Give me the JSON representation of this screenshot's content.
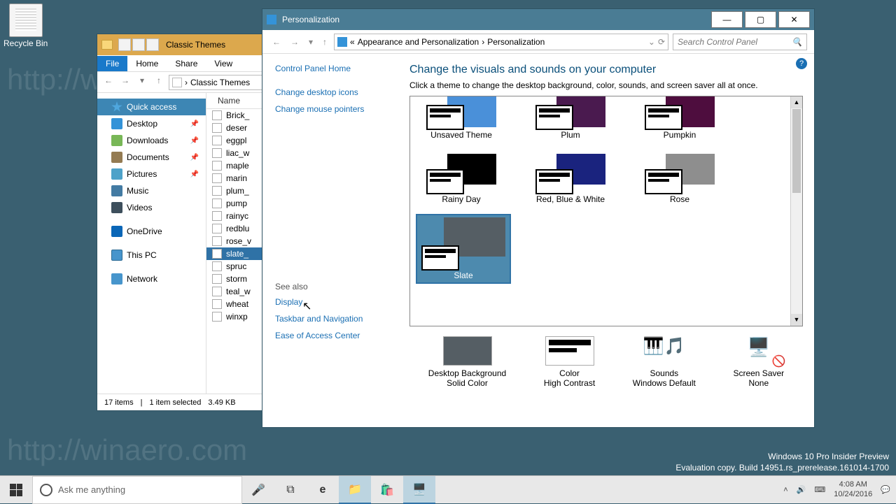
{
  "desktop": {
    "recycle_bin": "Recycle Bin"
  },
  "watermark": {
    "line1": "Windows 10 Pro Insider Preview",
    "line2": "Evaluation copy. Build 14951.rs_prerelease.161014-1700"
  },
  "explorer": {
    "title": "Classic Themes",
    "tabs": {
      "file": "File",
      "home": "Home",
      "share": "Share",
      "view": "View"
    },
    "breadcrumb": "Classic Themes",
    "columns": {
      "name": "Name"
    },
    "sidebar": {
      "quick": "Quick access",
      "desktop": "Desktop",
      "downloads": "Downloads",
      "documents": "Documents",
      "pictures": "Pictures",
      "music": "Music",
      "videos": "Videos",
      "onedrive": "OneDrive",
      "thispc": "This PC",
      "network": "Network"
    },
    "files": {
      "0": "Brick_",
      "1": "deser",
      "2": "eggpl",
      "3": "liac_w",
      "4": "maple",
      "5": "marin",
      "6": "plum_",
      "7": "pump",
      "8": "rainyc",
      "9": "redblu",
      "10": "rose_v",
      "11": "slate_",
      "12": "spruc",
      "13": "storm",
      "14": "teal_w",
      "15": "wheat",
      "16": "winxp"
    },
    "status": {
      "items": "17 items",
      "selected": "1 item selected",
      "size": "3.49 KB"
    }
  },
  "personalization": {
    "title": "Personalization",
    "breadcrumb": {
      "p1": "Appearance and Personalization",
      "p2": "Personalization"
    },
    "search_placeholder": "Search Control Panel",
    "side": {
      "home": "Control Panel Home",
      "icons": "Change desktop icons",
      "pointers": "Change mouse pointers",
      "seealso": "See also",
      "display": "Display",
      "tasknav": "Taskbar and Navigation",
      "ease": "Ease of Access Center"
    },
    "heading": "Change the visuals and sounds on your computer",
    "sub": "Click a theme to change the desktop background, color, sounds, and screen saver all at once.",
    "themes": {
      "unsaved": "Unsaved Theme",
      "plum": "Plum",
      "pumpkin": "Pumpkin",
      "rainy": "Rainy Day",
      "rbw": "Red, Blue & White",
      "rose": "Rose",
      "slate": "Slate"
    },
    "theme_colors": {
      "unsaved": "#4a90d9",
      "plum": "#4a1a4f",
      "pumpkin": "#4e0d3e",
      "rainy": "#000000",
      "rbw": "#1a237e",
      "rose": "#8e8e8e",
      "slate": "#555e64"
    },
    "bottom": {
      "bg": {
        "t": "Desktop Background",
        "v": "Solid Color"
      },
      "color": {
        "t": "Color",
        "v": "High Contrast"
      },
      "sounds": {
        "t": "Sounds",
        "v": "Windows Default"
      },
      "saver": {
        "t": "Screen Saver",
        "v": "None"
      }
    }
  },
  "taskbar": {
    "search_placeholder": "Ask me anything",
    "clock": {
      "time": "4:08 AM",
      "date": "10/24/2016"
    }
  }
}
